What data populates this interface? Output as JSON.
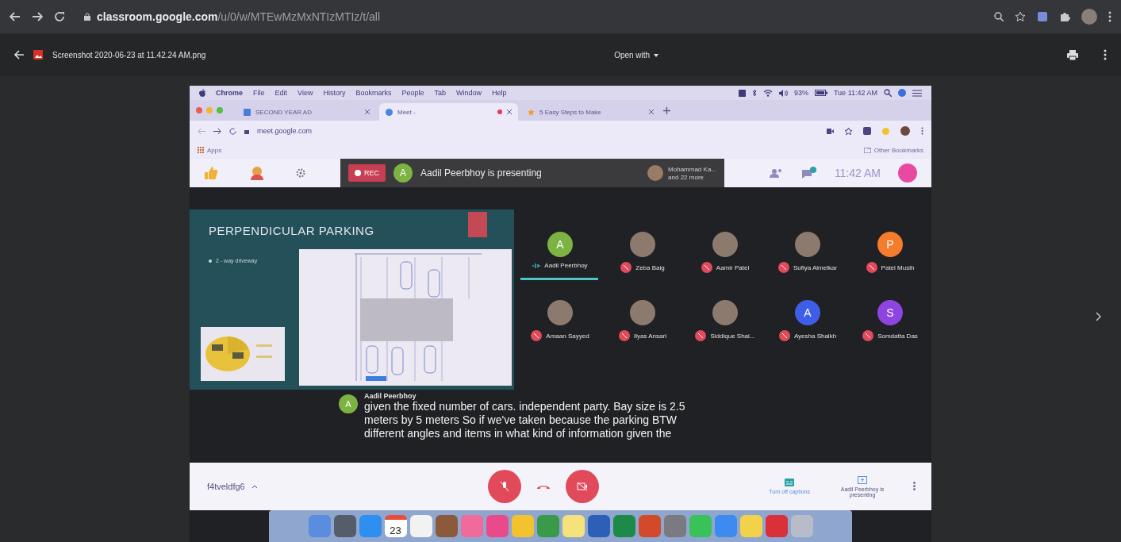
{
  "browser": {
    "url_host": "classroom.google.com",
    "url_path": "/u/0/w/MTEwMzMxNTIzMTIz/t/all"
  },
  "viewer": {
    "file_name": "Screenshot 2020-06-23 at 11.42.24 AM.png",
    "open_with": "Open with"
  },
  "screenshot": {
    "menu_bar": {
      "app": "Chrome",
      "items": [
        "File",
        "Edit",
        "View",
        "History",
        "Bookmarks",
        "People",
        "Tab",
        "Window",
        "Help"
      ],
      "battery": "93%",
      "clock": "Tue 11:42 AM"
    },
    "tabs": [
      {
        "title": "SECOND YEAR AD",
        "selected": false,
        "recording": false
      },
      {
        "title": "Meet -",
        "selected": true,
        "recording": true
      },
      {
        "title": "5 Easy Steps to Make",
        "selected": false,
        "recording": false
      }
    ],
    "address": "meet.google.com",
    "bookmarks": {
      "apps": "Apps",
      "other": "Other Bookmarks"
    },
    "meet_top": {
      "rec": "REC",
      "presenter_initial": "A",
      "presenting": "Aadil Peerbhoy is presenting",
      "others_name": "Mohammad Ka...",
      "others_more": "and 22 more",
      "time": "11:42 AM"
    },
    "slide": {
      "title": "PERPENDICULAR PARKING",
      "bullet": "2 - way driveway"
    },
    "participants": [
      {
        "name": "Aadil Peerbhoy",
        "kind": "letter",
        "initial": "A",
        "color": "#7cb342",
        "muted": false,
        "speaking": true
      },
      {
        "name": "Zeba Baig",
        "kind": "photo",
        "muted": true,
        "speaking": false
      },
      {
        "name": "Aamir Patel",
        "kind": "photo",
        "muted": true,
        "speaking": false
      },
      {
        "name": "Sufiya Almelkar",
        "kind": "photo",
        "muted": true,
        "speaking": false
      },
      {
        "name": "Patel Musih",
        "kind": "letter",
        "initial": "P",
        "color": "#f57c2c",
        "muted": true,
        "speaking": false
      },
      {
        "name": "Amaan Sayyed",
        "kind": "photo",
        "muted": true,
        "speaking": false
      },
      {
        "name": "Ilyas Ansari",
        "kind": "photo",
        "muted": true,
        "speaking": false
      },
      {
        "name": "Siddique Shai...",
        "kind": "photo",
        "muted": true,
        "speaking": false
      },
      {
        "name": "Ayesha Shaikh",
        "kind": "letter",
        "initial": "A",
        "color": "#3f5ee8",
        "muted": true,
        "speaking": false
      },
      {
        "name": "Somdatta Das",
        "kind": "letter",
        "initial": "S",
        "color": "#8e44e0",
        "muted": true,
        "speaking": false
      }
    ],
    "caption": {
      "initial": "A",
      "speaker": "Aadil Peerbhoy",
      "lines": [
        "given the fixed number of cars. independent party. Bay size is 2.5",
        "meters by 5 meters So if we've taken because the parking BTW",
        "different angles and items in what kind of information given the"
      ]
    },
    "bottom_bar": {
      "meeting_code": "f4tveldfg6",
      "captions": "Turn off captions",
      "presenting": "Aadil Peerbhoy is presenting"
    },
    "dock": {
      "calendar_day": "23"
    }
  }
}
